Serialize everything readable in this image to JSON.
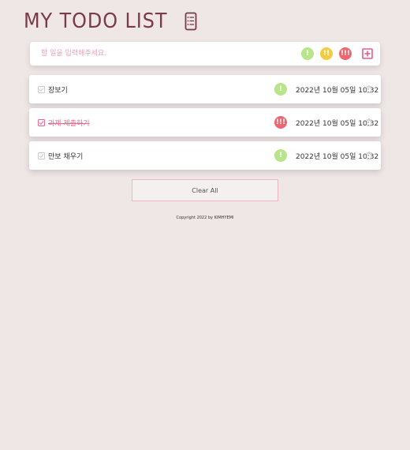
{
  "header": {
    "title": "MY TODO LIST",
    "icon": "notepad-icon"
  },
  "input": {
    "placeholder": "할 일을 입력해주세요.",
    "value": ""
  },
  "priorities": [
    {
      "level": "low",
      "label": "!",
      "color": "#b8e48a"
    },
    {
      "level": "medium",
      "label": "!!",
      "color": "#f3cc45"
    },
    {
      "level": "high",
      "label": "!!!",
      "color": "#ee6670"
    }
  ],
  "add_button": {
    "icon": "plus-square-icon",
    "color": "#ee5a8a"
  },
  "todos": [
    {
      "text": "장보기",
      "done": false,
      "priority": "!",
      "priority_level": "low",
      "date": "2022년 10월 05일 10:32"
    },
    {
      "text": "과제 제출하기",
      "done": true,
      "priority": "!!!",
      "priority_level": "high",
      "date": "2022년 10월 05일 10:32"
    },
    {
      "text": "만보 채우기",
      "done": false,
      "priority": "!",
      "priority_level": "low",
      "date": "2022년 10월 05일 10:32"
    }
  ],
  "clear_button": {
    "label": "Clear All"
  },
  "footer": {
    "copyright": "Copyright 2022 by KIMHYEMI"
  },
  "colors": {
    "background": "#efe6e6",
    "accent": "#ee5a8a",
    "title": "#7a3a48",
    "done_text": "#ee6a8d"
  }
}
